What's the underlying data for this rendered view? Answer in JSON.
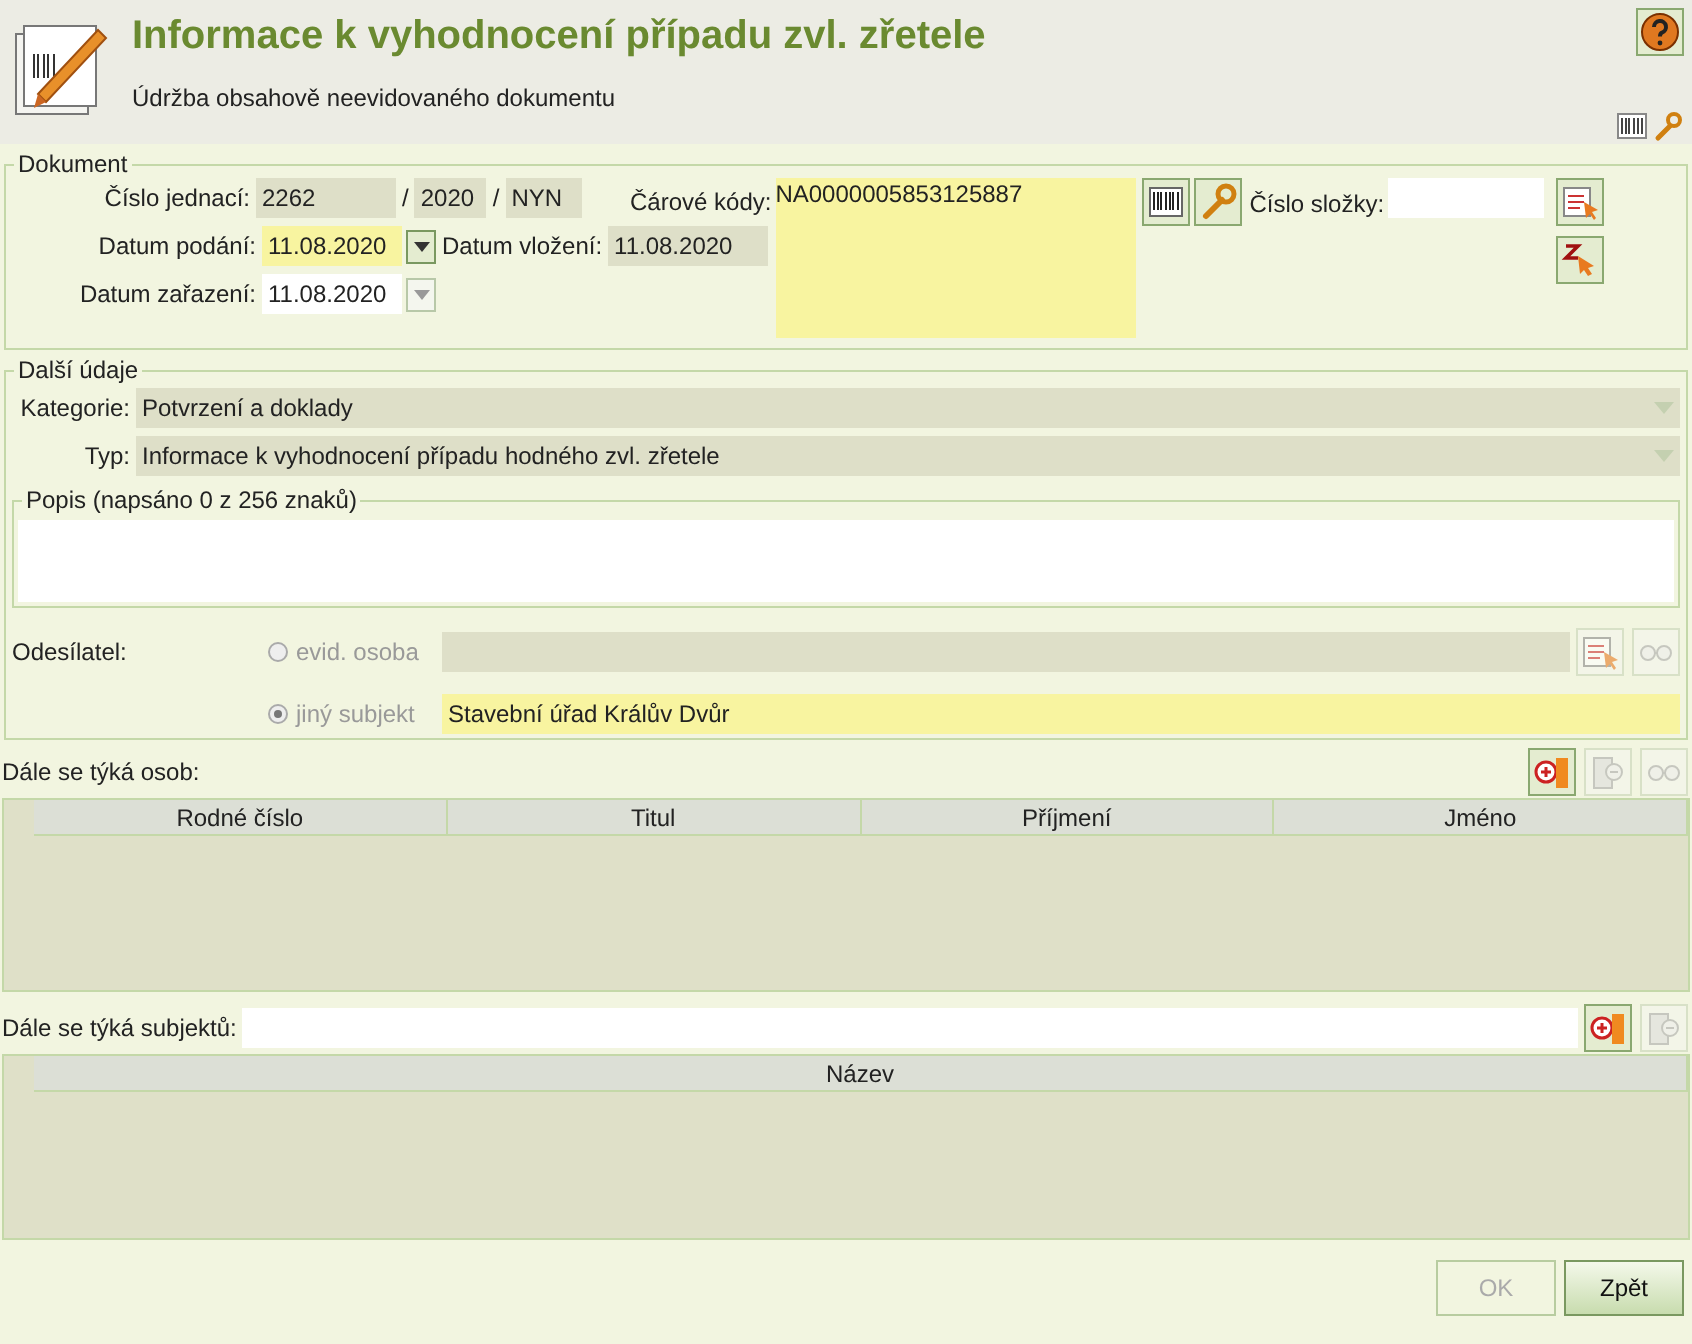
{
  "header": {
    "title": "Informace k vyhodnocení případu zvl. zřetele",
    "subtitle": "Údržba obsahově neevidovaného dokumentu"
  },
  "dokument": {
    "legend": "Dokument",
    "cislo_jednaci": {
      "label": "Číslo jednací:",
      "number": "2262",
      "sep1": "/",
      "year": "2020",
      "sep2": "/",
      "suffix": "NYN"
    },
    "datum_podani": {
      "label": "Datum podání:",
      "value": "11.08.2020",
      "disabled": false
    },
    "datum_vlozeni": {
      "label": "Datum vložení:",
      "value": "11.08.2020"
    },
    "datum_zarazeni": {
      "label": "Datum zařazení:",
      "value": "11.08.2020",
      "disabled": true
    },
    "carove_kody": {
      "label": "Čárové kódy:",
      "value": "NA0000005853125887"
    },
    "cislo_slozky": {
      "label": "Číslo složky:"
    }
  },
  "dalsi_udaje": {
    "legend": "Další údaje",
    "kategorie": {
      "label": "Kategorie:",
      "value": "Potvrzení a doklady"
    },
    "typ": {
      "label": "Typ:",
      "value": "Informace k vyhodnocení případu hodného zvl. zřetele"
    },
    "popis": {
      "legend": "Popis (napsáno 0 z 256 znaků)"
    },
    "odesilatel": {
      "label": "Odesílatel:",
      "options": [
        {
          "label": "evid. osoba",
          "selected": false,
          "disabled": true
        },
        {
          "label": "jiný subjekt",
          "selected": true,
          "value": "Stavební úřad Králův Dvůr",
          "disabled": false
        }
      ]
    }
  },
  "osoby": {
    "label": "Dále se týká osob:",
    "buttons": [
      {
        "disabled": false
      },
      {
        "disabled": true
      },
      {
        "disabled": true
      }
    ],
    "columns": [
      "Rodné číslo",
      "Titul",
      "Příjmení",
      "Jméno"
    ]
  },
  "subjekty": {
    "label": "Dále se týká subjektů:",
    "buttons": [
      {
        "disabled": false
      },
      {
        "disabled": true
      }
    ],
    "columns": [
      "Název"
    ]
  },
  "buttons": [
    {
      "label": "OK",
      "disabled": true
    },
    {
      "label": "Zpět",
      "disabled": false
    }
  ]
}
